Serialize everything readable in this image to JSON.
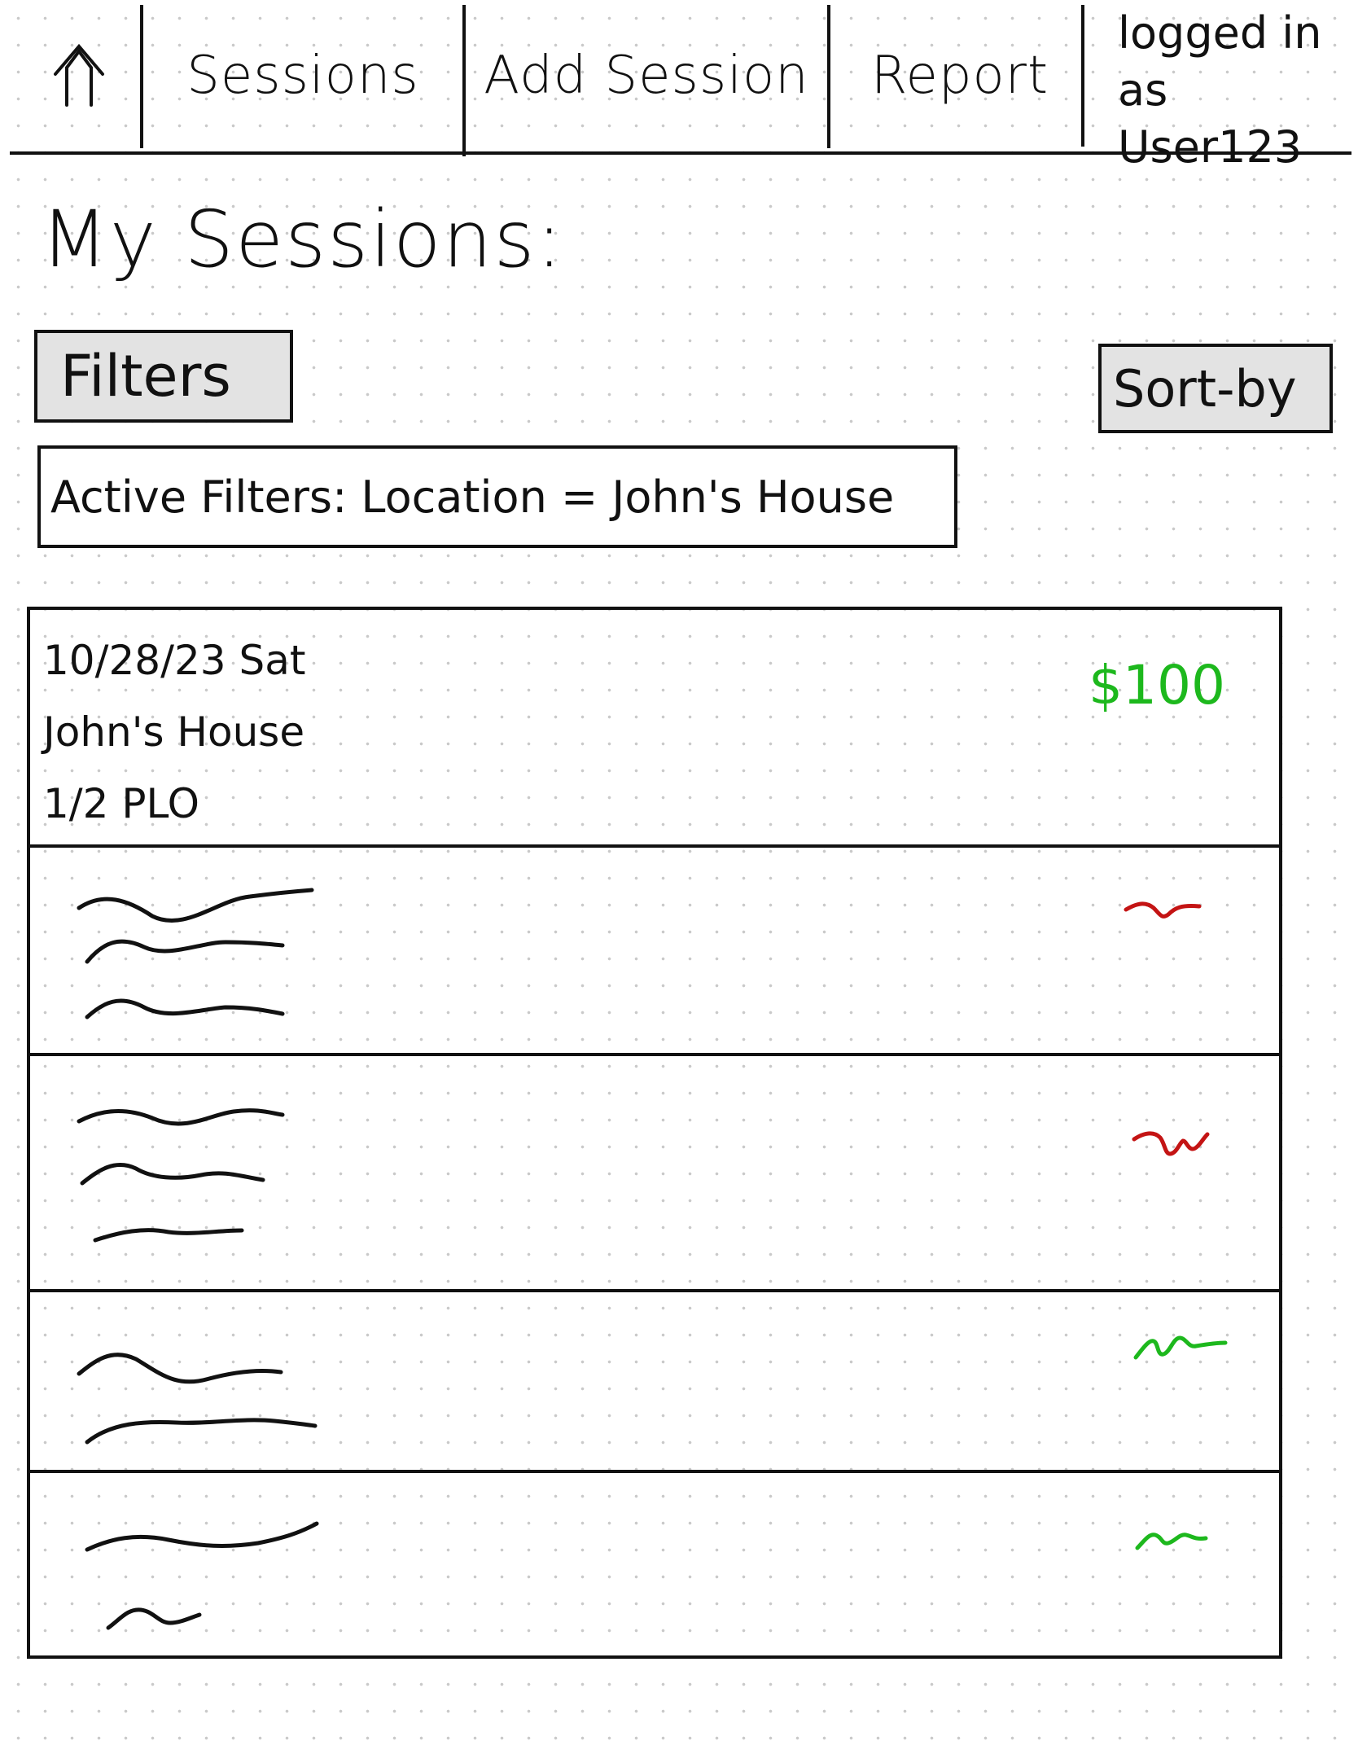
{
  "nav": {
    "home_icon": "up-arrow-icon",
    "items": [
      {
        "label": "Sessions"
      },
      {
        "label": "Add Session"
      },
      {
        "label": "Report"
      }
    ],
    "user_line1": "logged in as",
    "user_line2": "User123"
  },
  "page": {
    "title": "My Sessions:"
  },
  "controls": {
    "filters_label": "Filters",
    "sort_label": "Sort-by",
    "active_filters": "Active Filters: Location = John's House"
  },
  "sessions": [
    {
      "date": "10/28/23 Sat",
      "location": "John's House",
      "game": "1/2 PLO",
      "amount": "$100",
      "amount_color": "#1db81d"
    }
  ],
  "colors": {
    "ink": "#111111",
    "positive": "#1db81d",
    "negative": "#c41414",
    "button_fill": "#e3e3e3"
  }
}
